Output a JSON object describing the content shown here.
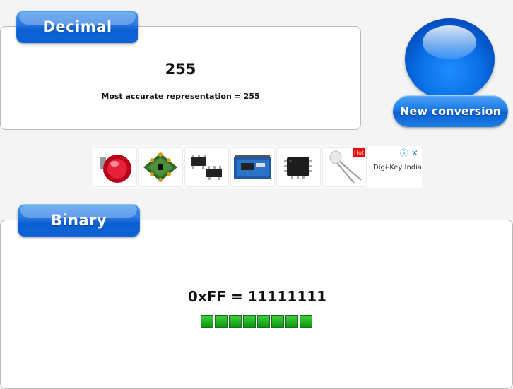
{
  "decimal": {
    "tab_label": "Decimal",
    "value": "255",
    "representation": "Most accurate representation = 255"
  },
  "new_conversion": {
    "label": "New conversion"
  },
  "ad": {
    "hot_badge": "Hot",
    "brand": "Digi-Key India",
    "info_icon": "info-icon",
    "close_icon": "close-icon",
    "products": [
      "push-button-icon",
      "rf-module-icon",
      "transistor-icon",
      "dev-board-icon",
      "ic-chip-icon",
      "led-icon"
    ]
  },
  "binary": {
    "tab_label": "Binary",
    "value": "0xFF = 11111111",
    "bits": [
      1,
      1,
      1,
      1,
      1,
      1,
      1,
      1
    ]
  },
  "colors": {
    "accent_blue": "#0c63d6",
    "bit_on": "#0c9a0c"
  }
}
